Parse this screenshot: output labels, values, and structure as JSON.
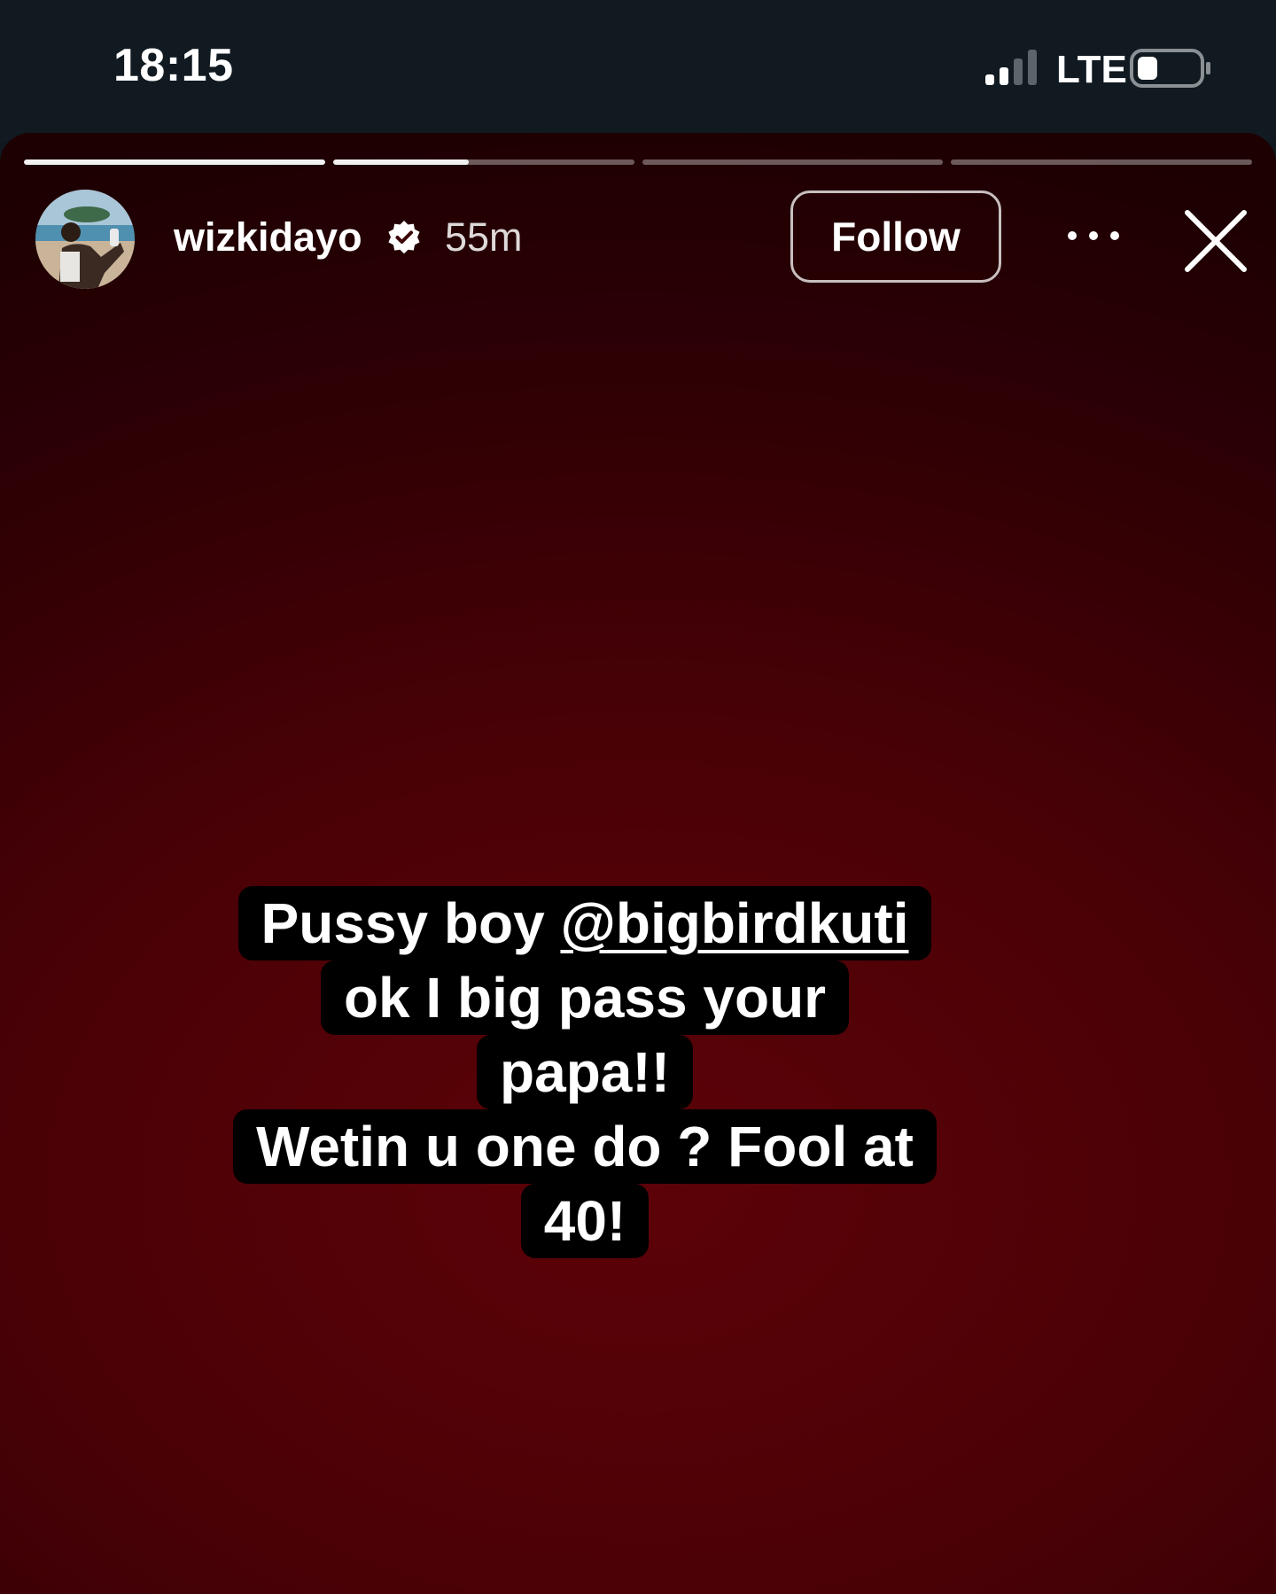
{
  "status_bar": {
    "time": "18:15",
    "network": "LTE",
    "signal_icon": "signal-bars-icon",
    "battery_icon": "battery-icon"
  },
  "story": {
    "progress": [
      1.0,
      0.45,
      0.0,
      0.0
    ],
    "user": {
      "username": "wizkidayo",
      "verified": true,
      "time_ago": "55m"
    },
    "follow_label": "Follow",
    "more_icon": "more-horizontal-icon",
    "close_icon": "close-icon",
    "caption": {
      "line1_text": "Pussy boy ",
      "mention": "@bigbirdkuti",
      "line2": "ok I big pass your",
      "line3": "papa!!",
      "line4": "Wetin u one do ? Fool at",
      "line5": "40!"
    },
    "colors": {
      "background": "#4a0106",
      "text_box": "#000000",
      "status_bar": "#111a20"
    }
  }
}
